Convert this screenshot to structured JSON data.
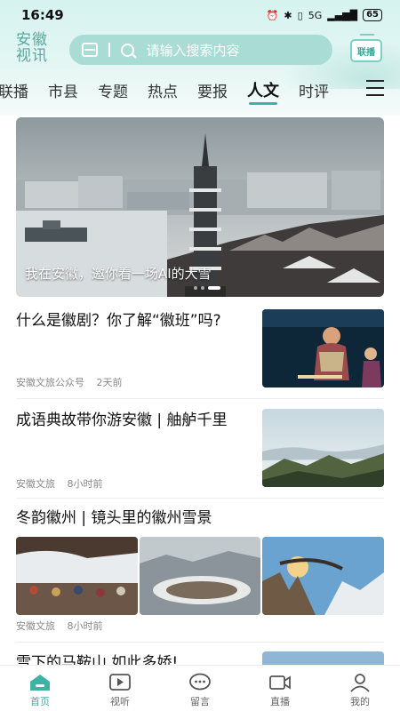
{
  "status": {
    "time": "16:49",
    "signal": "5G",
    "battery": "65"
  },
  "header": {
    "logo_line1": "安徽",
    "logo_line2": "视讯",
    "search_placeholder": "请输入搜索内容",
    "live_label": "联播"
  },
  "tabs": [
    {
      "label": "联播"
    },
    {
      "label": "市县"
    },
    {
      "label": "专题"
    },
    {
      "label": "热点"
    },
    {
      "label": "要报"
    },
    {
      "label": "人文",
      "active": true
    },
    {
      "label": "时评"
    }
  ],
  "banner": {
    "caption": "我在安徽，邀你看一场AI的大雪"
  },
  "news": [
    {
      "title": "什么是徽剧？你了解“徽班”吗?",
      "source": "安徽文旅公众号",
      "time": "2天前"
    },
    {
      "title": "成语典故带你游安徽 | 舳舻千里",
      "source": "安徽文旅",
      "time": "8小时前"
    },
    {
      "title": "冬韵徽州 | 镜头里的徽州雪景",
      "source": "安徽文旅",
      "time": "8小时前"
    },
    {
      "title": "雪下的马鞍山 如此多娇!"
    }
  ],
  "bottom_nav": [
    {
      "label": "首页",
      "icon": "home-icon",
      "active": true
    },
    {
      "label": "视听",
      "icon": "video-icon"
    },
    {
      "label": "留言",
      "icon": "chat-icon"
    },
    {
      "label": "直播",
      "icon": "live-camera-icon"
    },
    {
      "label": "我的",
      "icon": "user-icon"
    }
  ],
  "colors": {
    "accent": "#3bb3a5",
    "header_bg": "#d6f3f0",
    "search_bg": "#a9dcd5"
  }
}
